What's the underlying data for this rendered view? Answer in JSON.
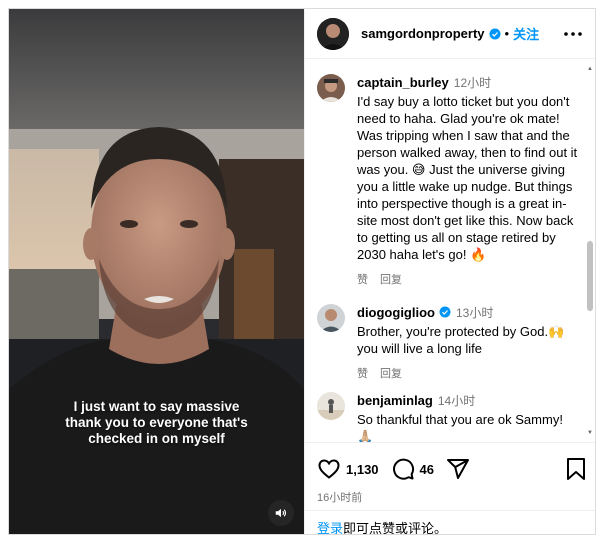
{
  "post": {
    "username": "samgordonproperty",
    "dot": "•",
    "follow_label": "关注",
    "caption_lines": [
      "I just want to say massive",
      "thank you to everyone that's",
      "checked in on myself"
    ],
    "likes": "1,130",
    "comments_count": "46",
    "post_time": "16小时前"
  },
  "comments": [
    {
      "username": "captain_burley",
      "time": "12小时",
      "text": "I'd say buy a lotto ticket but you don't need to haha. Glad you're ok mate! Was tripping when I saw that and the person walked away, then to find out it was you. 😅 Just the universe giving you a little wake up nudge. But things into perspective though is a great in-site most don't get like this. Now back to getting us all on stage retired by 2030 haha let's go! 🔥",
      "like_label": "赞",
      "reply_label": "回复"
    },
    {
      "username": "diogogiglioo",
      "time": "13小时",
      "text": "Brother, you're protected by God.🙌 you will live a long life",
      "like_label": "赞",
      "reply_label": "回复"
    },
    {
      "username": "benjaminlag",
      "time": "14小时",
      "text": "So thankful that you are ok Sammy! 🙏🏼"
    }
  ],
  "login": {
    "link": "登录",
    "text": "即可点赞或评论。"
  },
  "colors": {
    "accent": "#0095f6",
    "muted": "#737373",
    "border": "#dbdbdb"
  },
  "icons": [
    "heart-icon",
    "comment-icon",
    "share-icon",
    "bookmark-icon",
    "more-icon",
    "verified-icon",
    "sound-icon"
  ]
}
